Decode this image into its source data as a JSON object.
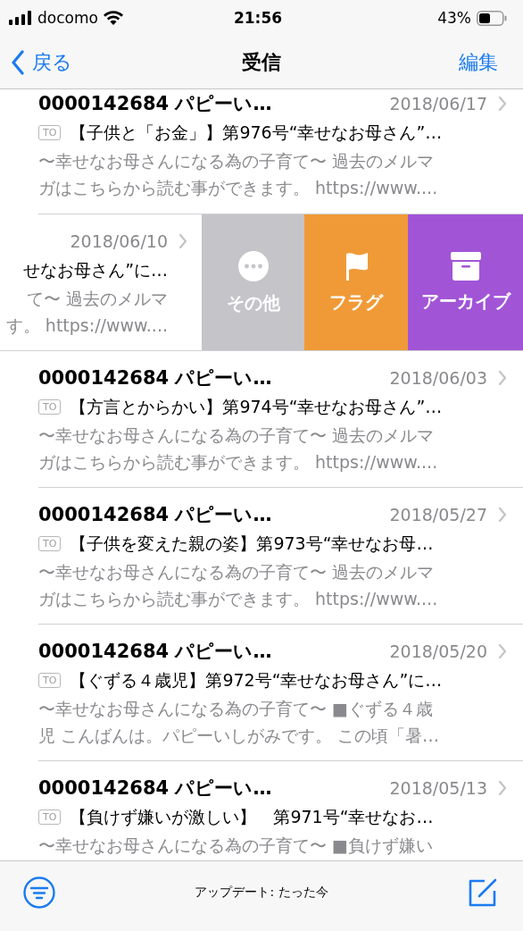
{
  "status_bar": {
    "carrier": "docomo",
    "time": "21:56",
    "battery": "43%"
  },
  "nav": {
    "back": "戻る",
    "title": "受信",
    "action": "編集"
  },
  "messages": [
    {
      "swiped": false,
      "sender": "0000142684 パピーい…",
      "date": "2018/06/17",
      "badge": "TO",
      "subject": "【子供と「お金」】第976号“幸せなお母さん”…",
      "preview": [
        "〜幸せなお母さんになる為の子育て〜 過去のメルマ",
        "ガはこちらから読む事ができます。 https://www...."
      ]
    },
    {
      "swiped": true,
      "date": "2018/06/10",
      "subject": "せなお母さん”に…",
      "preview": [
        "て〜 過去のメルマ",
        "す。 https://www...."
      ],
      "actions": [
        {
          "kind": "more",
          "label": "その他"
        },
        {
          "kind": "flag",
          "label": "フラグ"
        },
        {
          "kind": "archive",
          "label": "アーカイブ"
        }
      ]
    },
    {
      "swiped": false,
      "sender": "0000142684 パピーい…",
      "date": "2018/06/03",
      "badge": "TO",
      "subject": "【方言とからかい】第974号“幸せなお母さん”…",
      "preview": [
        "〜幸せなお母さんになる為の子育て〜 過去のメルマ",
        "ガはこちらから読む事ができます。 https://www...."
      ]
    },
    {
      "swiped": false,
      "sender": "0000142684 パピーい…",
      "date": "2018/05/27",
      "badge": "TO",
      "subject": "【子供を変えた親の姿】第973号“幸せなお母…",
      "preview": [
        "〜幸せなお母さんになる為の子育て〜 過去のメルマ",
        "ガはこちらから読む事ができます。 https://www...."
      ]
    },
    {
      "swiped": false,
      "sender": "0000142684 パピーい…",
      "date": "2018/05/20",
      "badge": "TO",
      "subject": "【ぐずる４歳児】第972号“幸せなお母さん”に…",
      "preview": [
        "〜幸せなお母さんになる為の子育て〜 ■ぐずる４歳",
        "児 こんばんは。パピーいしがみです。 この頃「暑…"
      ]
    },
    {
      "swiped": false,
      "sender": "0000142684 パピーい…",
      "date": "2018/05/13",
      "badge": "TO",
      "subject": "【負けず嫌いが激しい】　第971号“幸せなお…",
      "preview": [
        "〜幸せなお母さんになる為の子育て〜 ■負けず嫌い"
      ]
    }
  ],
  "toolbar": {
    "status": "アップデート: たった今"
  }
}
